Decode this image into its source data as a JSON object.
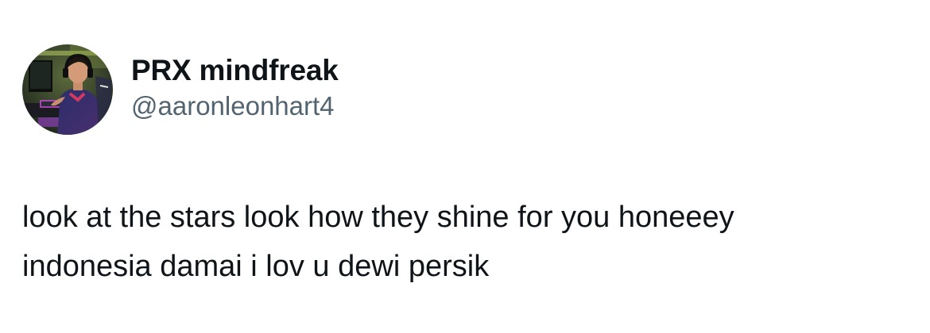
{
  "author": {
    "display_name": "PRX mindfreak",
    "handle": "@aaronleonhart4",
    "avatar_icon": "profile-photo-gamer-avatar"
  },
  "tweet": {
    "lines": [
      "look at the stars look how they shine for you honeeey",
      "indonesia damai i lov u dewi persik"
    ]
  },
  "colors": {
    "text_primary": "#0f1419",
    "text_secondary": "#536471",
    "background": "#ffffff"
  }
}
